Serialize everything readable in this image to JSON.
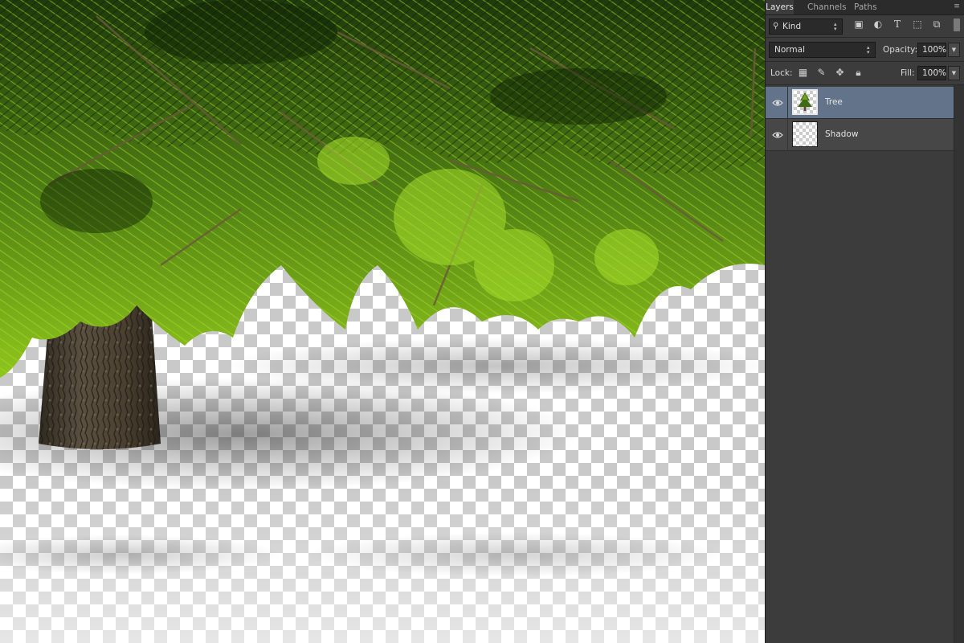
{
  "panel": {
    "tabs": [
      "Layers",
      "Channels",
      "Paths"
    ],
    "active_tab": "Layers",
    "filter": {
      "value": "Kind"
    },
    "blend_mode": {
      "value": "Normal"
    },
    "opacity": {
      "label": "Opacity:",
      "value": "100%"
    },
    "lock": {
      "label": "Lock:"
    },
    "fill": {
      "label": "Fill:",
      "value": "100%"
    },
    "filter_icons": [
      "image-filter-icon",
      "adjustment-filter-icon",
      "type-filter-icon",
      "shape-filter-icon",
      "smart-object-filter-icon"
    ],
    "lock_icons": [
      "lock-transparent-pixels-icon",
      "lock-image-pixels-icon",
      "lock-position-icon",
      "lock-all-icon"
    ],
    "layers": [
      {
        "name": "Tree",
        "visible": true,
        "selected": true
      },
      {
        "name": "Shadow",
        "visible": true,
        "selected": false
      }
    ],
    "selected_color": "#637389"
  }
}
